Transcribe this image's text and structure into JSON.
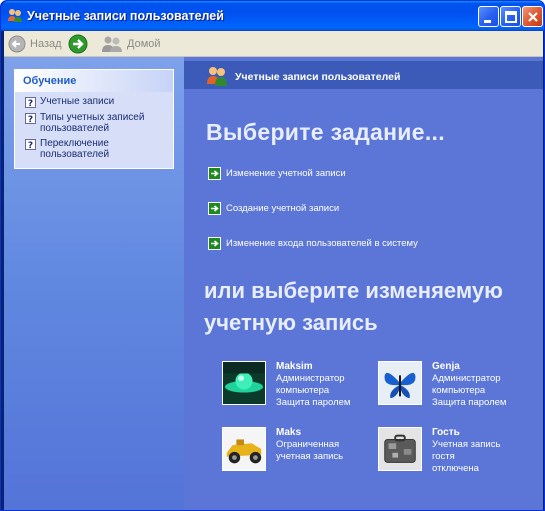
{
  "window": {
    "title": "Учетные записи пользователей",
    "accent": "#0054e3"
  },
  "toolbar": {
    "back_label": "Назад",
    "home_label": "Домой"
  },
  "learn": {
    "heading": "Обучение",
    "items": [
      {
        "label": "Учетные записи"
      },
      {
        "label": "Типы учетных записей пользователей"
      },
      {
        "label": "Переключение пользователей"
      }
    ]
  },
  "main": {
    "header": "Учетные записи пользователей",
    "pick_task": "Выберите задание...",
    "tasks": [
      {
        "label": "Изменение учетной записи"
      },
      {
        "label": "Создание учетной записи"
      },
      {
        "label": "Изменение входа пользователей в систему"
      }
    ],
    "or_choose": "или выберите изменяемую учетную запись",
    "accounts": [
      {
        "name": "Maksim",
        "lines": [
          "Администратор",
          "компьютера",
          "Защита паролем"
        ],
        "picture": "green-sphere"
      },
      {
        "name": "Genja",
        "lines": [
          "Администратор",
          "компьютера",
          "Защита паролем"
        ],
        "picture": "butterfly"
      },
      {
        "name": "Maks",
        "lines": [
          "Ограниченная",
          "учетная запись"
        ],
        "picture": "race-car"
      },
      {
        "name": "Гость",
        "lines": [
          "Учетная запись",
          "гостя",
          "отключена"
        ],
        "picture": "briefcase"
      }
    ]
  }
}
